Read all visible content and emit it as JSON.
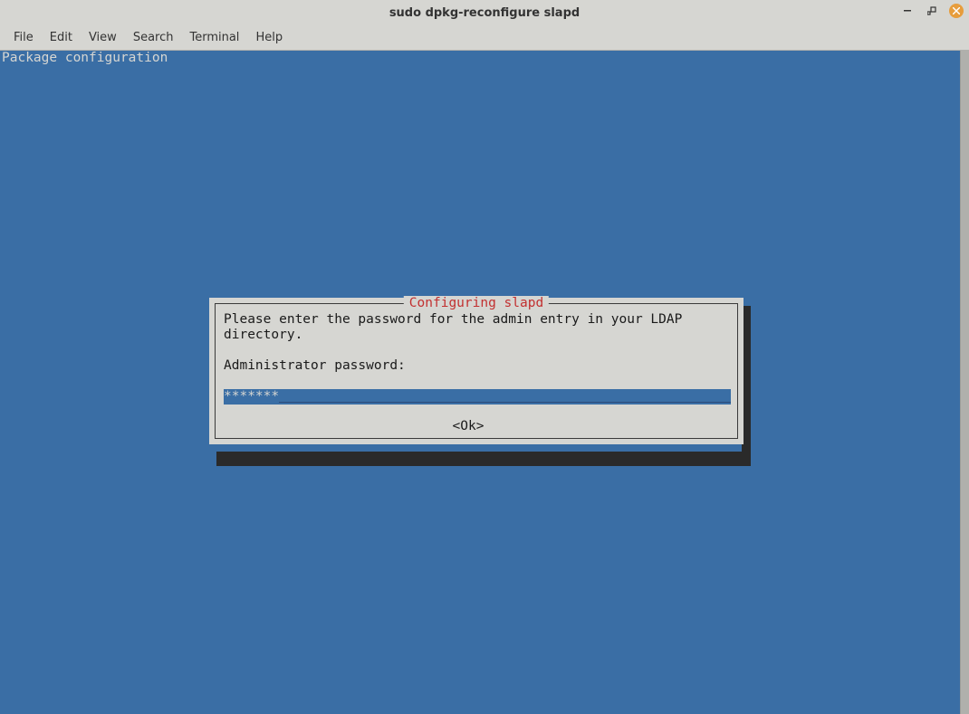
{
  "window": {
    "title": "sudo dpkg-reconfigure slapd"
  },
  "menubar": {
    "file": "File",
    "edit": "Edit",
    "view": "View",
    "search": "Search",
    "terminal": "Terminal",
    "help": "Help"
  },
  "terminal": {
    "header": "Package configuration"
  },
  "dialog": {
    "title": "Configuring slapd",
    "prompt": "Please enter the password for the admin entry in your LDAP directory.",
    "label": "Administrator password:",
    "password_value": "*******",
    "ok_label": "<Ok>"
  }
}
